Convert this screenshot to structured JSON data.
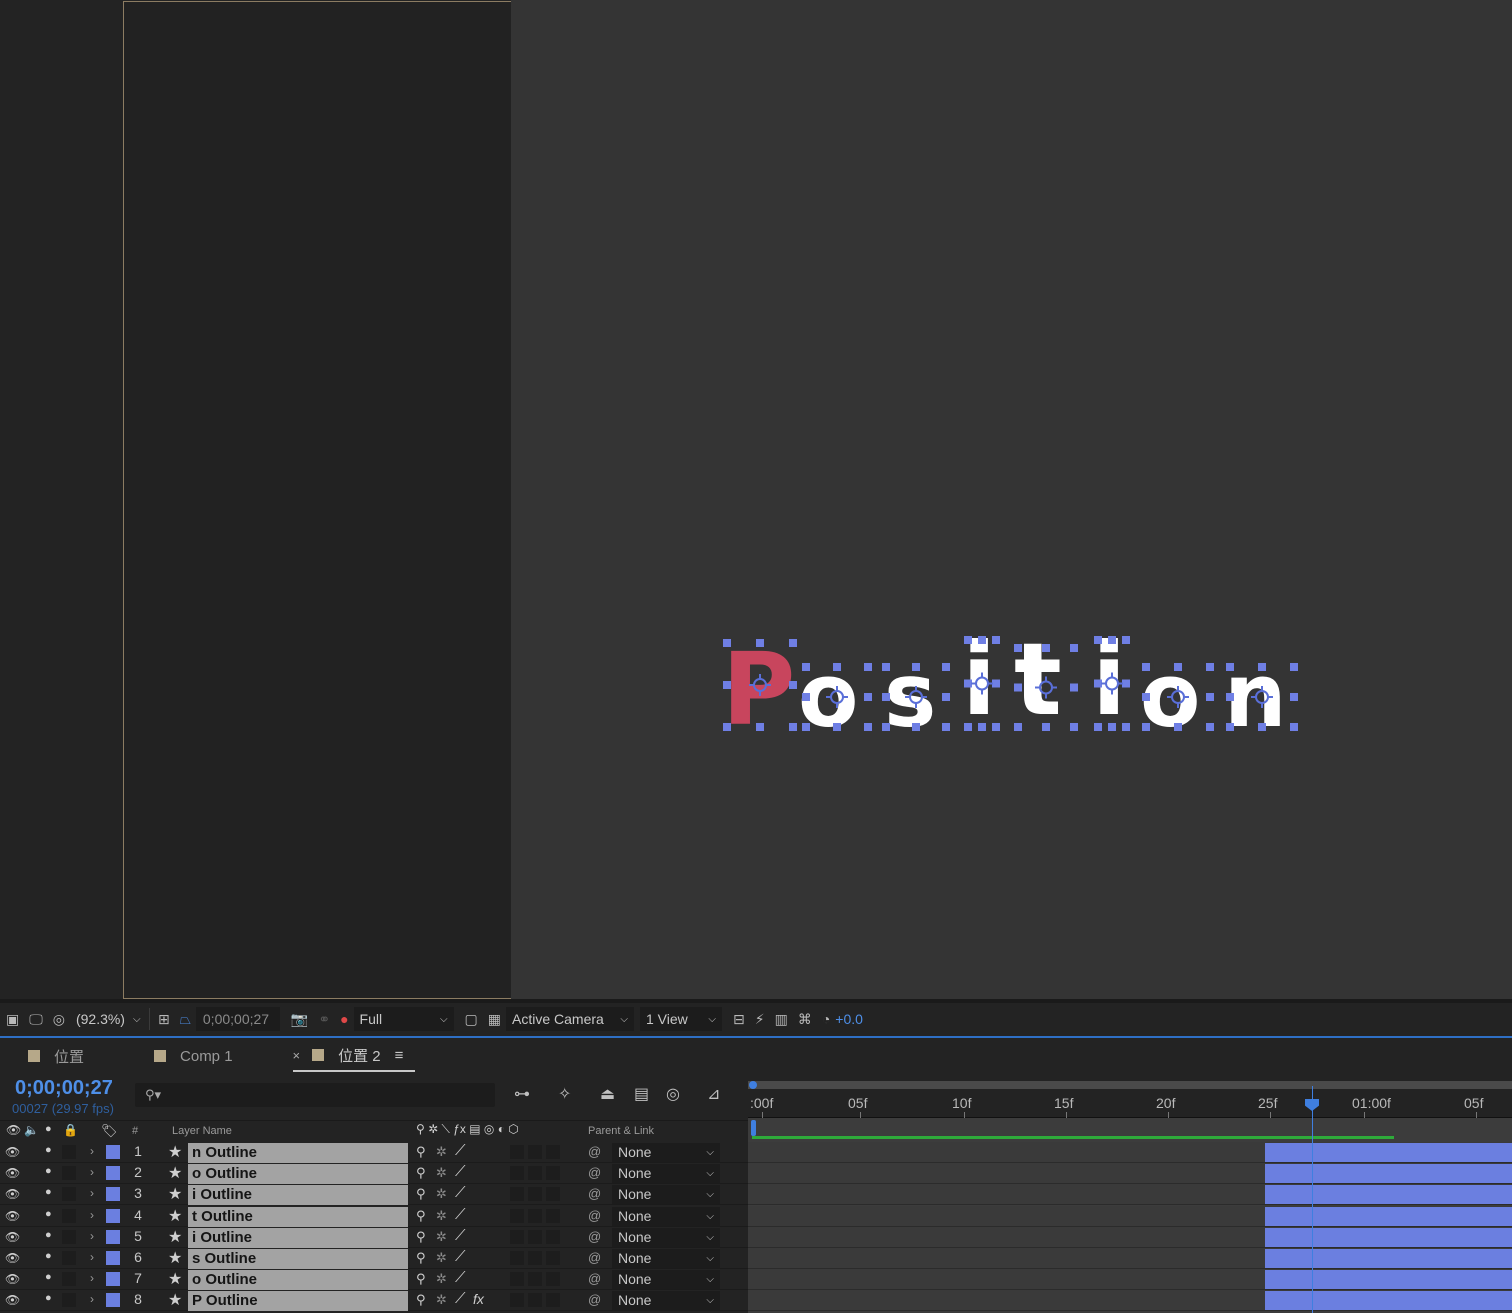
{
  "composition": {
    "letters": [
      "P",
      "o",
      "s",
      "i",
      "t",
      "i",
      "o",
      "n"
    ],
    "colors": {
      "highlight": "#c8455d",
      "letter": "#ffffff",
      "handle": "#6f7fe4"
    }
  },
  "viewer_toolbar": {
    "magnification": "(92.3%)",
    "timecode": "0;00;00;27",
    "resolution": "Full",
    "camera": "Active Camera",
    "views": "1 View",
    "exposure": "+0.0"
  },
  "tabs": [
    {
      "label": "位置",
      "active": false
    },
    {
      "label": "Comp 1",
      "active": false
    },
    {
      "label": "位置 2",
      "active": true
    }
  ],
  "timeline": {
    "timecode": "0;00;00;27",
    "frames": "00027 (29.97 fps)",
    "search_placeholder": "",
    "columns": {
      "num": "#",
      "layer_name": "Layer Name",
      "parent": "Parent & Link"
    },
    "ruler": [
      ":00f",
      "05f",
      "10f",
      "15f",
      "20f",
      "25f",
      "01:00f",
      "05f"
    ],
    "layers": [
      {
        "num": "1",
        "name": "n Outline",
        "parent": "None",
        "fx": false
      },
      {
        "num": "2",
        "name": "o Outline",
        "parent": "None",
        "fx": false
      },
      {
        "num": "3",
        "name": "i Outline",
        "parent": "None",
        "fx": false
      },
      {
        "num": "4",
        "name": "t Outline",
        "parent": "None",
        "fx": false
      },
      {
        "num": "5",
        "name": "i Outline",
        "parent": "None",
        "fx": false
      },
      {
        "num": "6",
        "name": "s Outline",
        "parent": "None",
        "fx": false
      },
      {
        "num": "7",
        "name": "o Outline",
        "parent": "None",
        "fx": false
      },
      {
        "num": "8",
        "name": "P Outline",
        "parent": "None",
        "fx": true
      }
    ],
    "current_frame": 27,
    "layer_in_frame": 25
  }
}
